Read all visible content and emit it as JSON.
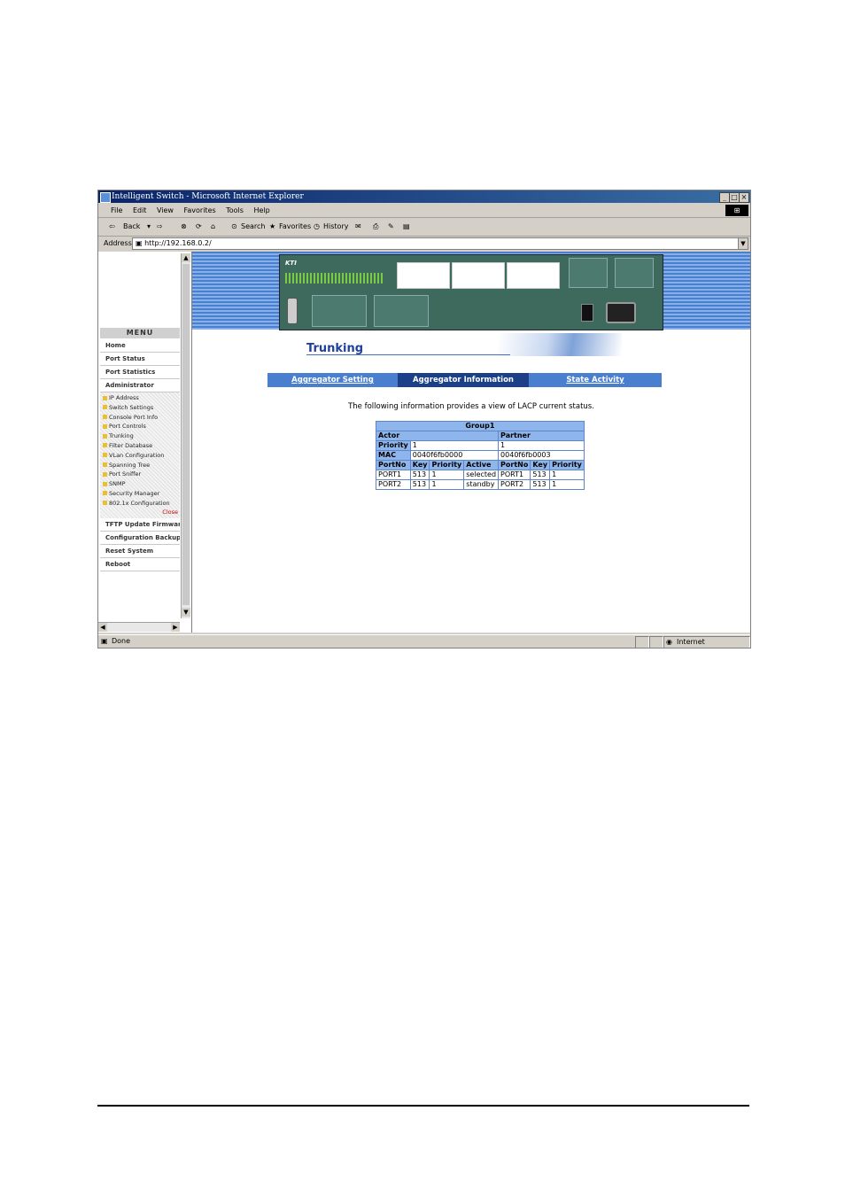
{
  "window": {
    "title": "Intelligent Switch - Microsoft Internet Explorer",
    "min": "_",
    "max": "□",
    "close": "×"
  },
  "menubar": [
    "File",
    "Edit",
    "View",
    "Favorites",
    "Tools",
    "Help"
  ],
  "toolbar": {
    "back": "Back",
    "search": "Search",
    "favorites": "Favorites",
    "history": "History"
  },
  "address": {
    "label": "Address",
    "url": "http://192.168.0.2/"
  },
  "sidebar": {
    "menu_title": "MENU",
    "items_top": [
      "Home",
      "Port Status",
      "Port Statistics",
      "Administrator"
    ],
    "subitems": [
      "IP Address",
      "Switch Settings",
      "Console Port Info",
      "Port Controls",
      "Trunking",
      "Filter Database",
      "VLan Configuration",
      "Spanning Tree",
      "Port Sniffer",
      "SNMP",
      "Security Manager",
      "802.1x Configuration"
    ],
    "close": "Close",
    "items_bottom": [
      "TFTP Update Firmware",
      "Configuration Backup",
      "Reset System",
      "Reboot"
    ]
  },
  "page": {
    "heading": "Trunking",
    "tabs": [
      "Aggregator Setting",
      "Aggregator Information",
      "State Activity"
    ],
    "intro": "The following information provides a view of LACP current status."
  },
  "lacp": {
    "group": "Group1",
    "actor_label": "Actor",
    "partner_label": "Partner",
    "priority_label": "Priority",
    "mac_label": "MAC",
    "actor_priority": "1",
    "partner_priority": "1",
    "actor_mac": "0040f6fb0000",
    "partner_mac": "0040f6fb0003",
    "columns": [
      "PortNo",
      "Key",
      "Priority",
      "Active",
      "PortNo",
      "Key",
      "Priority"
    ],
    "rows": [
      [
        "PORT1",
        "513",
        "1",
        "selected",
        "PORT1",
        "513",
        "1"
      ],
      [
        "PORT2",
        "513",
        "1",
        "standby",
        "PORT2",
        "513",
        "1"
      ]
    ]
  },
  "status": {
    "left": "Done",
    "zone": "Internet"
  }
}
